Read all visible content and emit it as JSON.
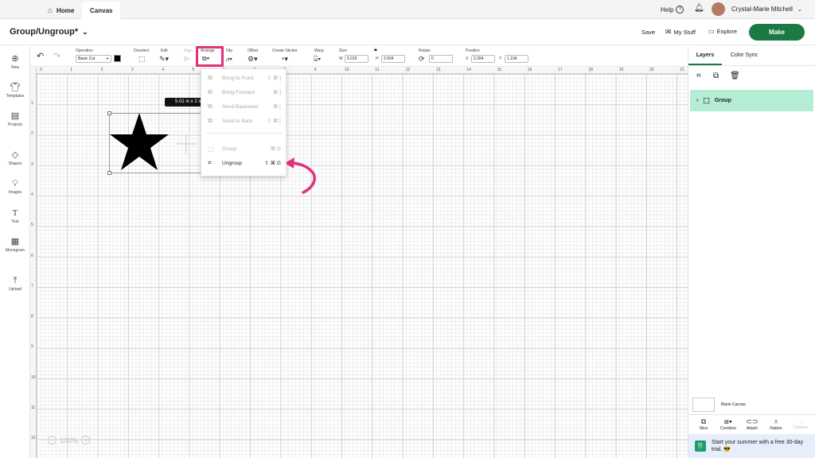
{
  "tabs": {
    "home": "Home",
    "canvas": "Canvas"
  },
  "topbar": {
    "help": "Help",
    "user": "Crystal-Marie Mitchell"
  },
  "titlebar": {
    "title": "Group/Ungroup*",
    "save": "Save",
    "my_stuff": "My Stuff",
    "explore": "Explore",
    "make": "Make"
  },
  "toolbar": {
    "operation": "Operation",
    "operation_value": "Basic Cut",
    "deselect": "Deselect",
    "edit": "Edit",
    "align": "Align",
    "arrange": "Arrange",
    "flip": "Flip",
    "offset": "Offset",
    "create_sticker": "Create Sticker",
    "warp": "Warp",
    "size": "Size",
    "w_label": "W",
    "w_value": "5.015",
    "h_label": "H",
    "h_value": "2.004",
    "rotate": "Rotate",
    "rotate_value": "0",
    "position": "Position",
    "x_label": "X",
    "x_value": "2.264",
    "y_label": "Y",
    "y_value": "1.194"
  },
  "leftnav": [
    {
      "label": "New",
      "icon": "plus-icon"
    },
    {
      "label": "Templates",
      "icon": "shirt-icon"
    },
    {
      "label": "Projects",
      "icon": "projects-icon"
    },
    {
      "label": "Shapes",
      "icon": "shapes-icon"
    },
    {
      "label": "Images",
      "icon": "bulb-icon"
    },
    {
      "label": "Text",
      "icon": "text-icon"
    },
    {
      "label": "Monogram",
      "icon": "monogram-icon"
    },
    {
      "label": "Upload",
      "icon": "upload-icon"
    }
  ],
  "ruler": {
    "top": [
      "0",
      "1",
      "2",
      "3",
      "4",
      "5",
      "6",
      "7",
      "8",
      "9",
      "10",
      "11",
      "12",
      "13",
      "14",
      "15",
      "16",
      "17",
      "18",
      "19",
      "20",
      "21"
    ],
    "left": [
      "1",
      "2",
      "3",
      "4",
      "5",
      "6",
      "7",
      "8",
      "9",
      "10",
      "11",
      "12"
    ]
  },
  "canvas": {
    "size_tooltip": "5.01 in x 2 in",
    "zoom": "100%"
  },
  "arrange_menu": [
    {
      "label": "Bring to Front",
      "shortcut": "⇧ ⌘ ]",
      "disabled": true
    },
    {
      "label": "Bring Forward",
      "shortcut": "⌘ ]",
      "disabled": true
    },
    {
      "label": "Send Backward",
      "shortcut": "⌘ [",
      "disabled": true
    },
    {
      "label": "Send to Back",
      "shortcut": "⇧ ⌘ [",
      "disabled": true
    },
    {
      "label": "Group",
      "shortcut": "⌘ G",
      "disabled": true
    },
    {
      "label": "Ungroup",
      "shortcut": "⇧ ⌘ G",
      "disabled": false
    }
  ],
  "rightpanel": {
    "tabs": [
      "Layers",
      "Color Sync"
    ],
    "layer_name": "Group",
    "blank_canvas": "Blank Canvas",
    "bottom_tools": [
      "Slice",
      "Combine",
      "Attach",
      "Flatten",
      "Contour"
    ],
    "promo": "Start your summer with a free 30-day trial. 😎"
  },
  "colors": {
    "make_button": "#1b7a43",
    "highlight": "#e0327a",
    "layer_selected": "#b4ecd4",
    "promo_bg": "#e6eefb"
  }
}
